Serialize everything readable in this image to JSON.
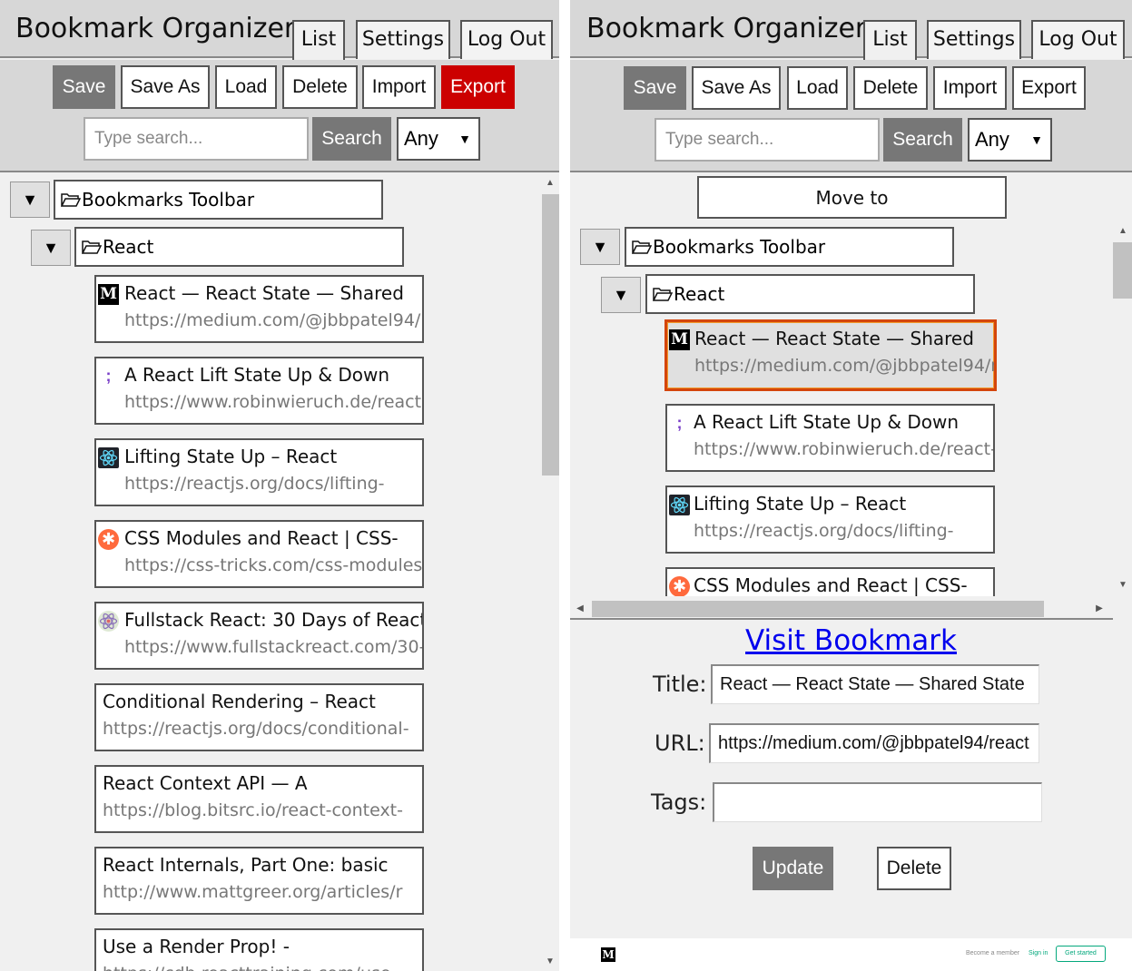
{
  "app": {
    "title": "Bookmark Organizer"
  },
  "tabs": {
    "list": "List",
    "settings": "Settings",
    "logout": "Log Out"
  },
  "toolbar": {
    "save": "Save",
    "save_as": "Save As",
    "load": "Load",
    "delete": "Delete",
    "import": "Import",
    "export": "Export",
    "search_placeholder": "Type search...",
    "search_button": "Search",
    "filter_value": "Any",
    "filter_arrow": "▼"
  },
  "tree": {
    "toggle_symbol": "▼",
    "root_folder": "Bookmarks Toolbar",
    "subfolder": "React",
    "bookmarks": [
      {
        "title": "React — React State — Shared",
        "url": "https://medium.com/@jbbpatel94/r",
        "icon": "medium-icon"
      },
      {
        "title": "A React Lift State Up & Down",
        "url": "https://www.robinwieruch.de/react-",
        "icon": "robinwieruch-icon"
      },
      {
        "title": "Lifting State Up – React",
        "url": "https://reactjs.org/docs/lifting-",
        "icon": "react-icon"
      },
      {
        "title": "CSS Modules and React | CSS-",
        "url": "https://css-tricks.com/css-modules-",
        "icon": "css-tricks-icon"
      },
      {
        "title": "Fullstack React: 30 Days of React",
        "url": "https://www.fullstackreact.com/30-",
        "icon": "fullstack-react-icon"
      },
      {
        "title": "Conditional Rendering – React",
        "url": "https://reactjs.org/docs/conditional-",
        "icon": ""
      },
      {
        "title": "React Context API — A",
        "url": "https://blog.bitsrc.io/react-context-",
        "icon": ""
      },
      {
        "title": "React Internals, Part One: basic",
        "url": "http://www.mattgreer.org/articles/r",
        "icon": ""
      },
      {
        "title": "Use a Render Prop! -",
        "url": "https://cdb.reacttraining.com/use-",
        "icon": ""
      }
    ]
  },
  "right": {
    "move_to": "Move to",
    "visit": "Visit Bookmark",
    "title_label": "Title:",
    "title_value": "React — React State — Shared State",
    "url_label": "URL:",
    "url_value": "https://medium.com/@jbbpatel94/react",
    "tags_label": "Tags:",
    "tags_value": "",
    "update": "Update",
    "delete": "Delete"
  },
  "preview": {
    "logo_letter": "M",
    "member": "Become a member",
    "signin": "Sign in",
    "get_started": "Get started"
  },
  "colors": {
    "export_active": "#cc0000",
    "selected_border": "#d4450c",
    "link": "#0000ee"
  }
}
